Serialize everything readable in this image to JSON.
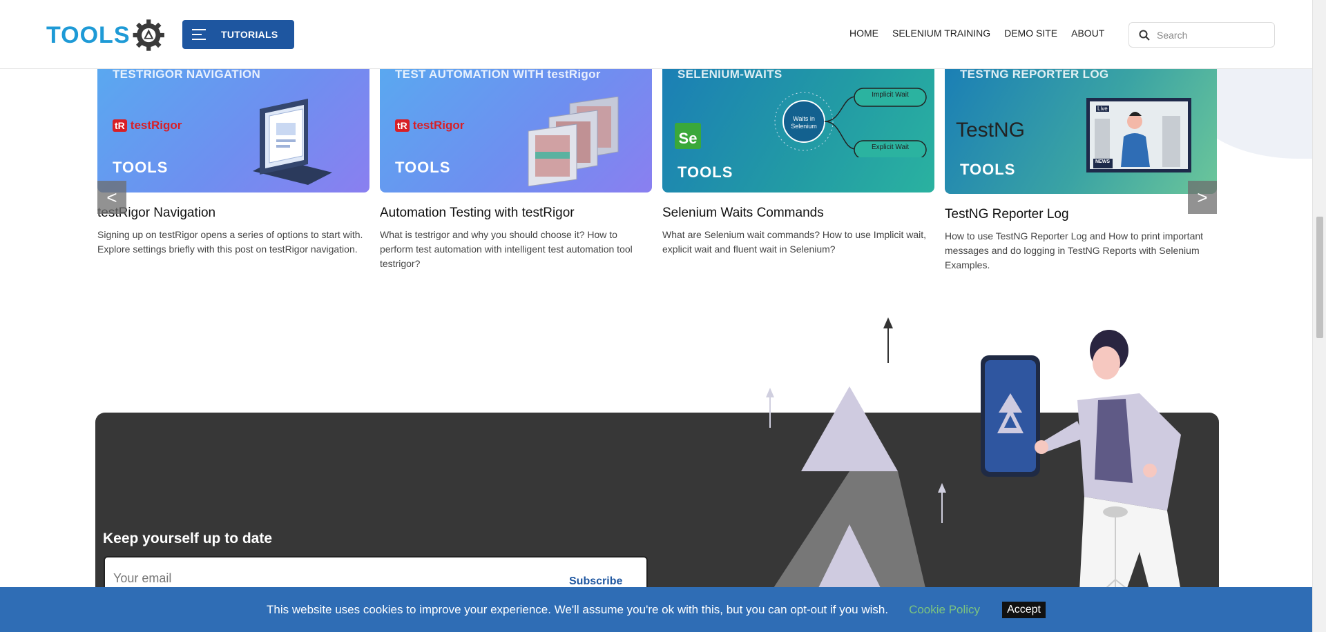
{
  "header": {
    "logo_text": "TOOLS",
    "tutorials_label": "TUTORIALS",
    "nav": [
      "HOME",
      "SELENIUM TRAINING",
      "DEMO SITE",
      "ABOUT"
    ],
    "search_placeholder": "Search"
  },
  "cards": [
    {
      "image_title": "TESTRIGOR NAVIGATION",
      "title": "testRigor Navigation",
      "description": "Signing up on testRigor opens a series of options to start with. Explore settings briefly with this post on testRigor navigation."
    },
    {
      "image_title": "TEST AUTOMATION WITH testRigor",
      "title": "Automation Testing with testRigor",
      "description": "What is testrigor and why you should choose it? How to perform test automation with intelligent test automation tool testrigor?"
    },
    {
      "image_title": "SELENIUM-WAITS",
      "title": "Selenium Waits Commands",
      "description": "What are Selenium wait commands? How to use Implicit wait, explicit wait and fluent wait in Selenium?",
      "diagram": {
        "center": "Waits in Selenium",
        "top": "Implicit Wait",
        "bottom": "Explicit Wait"
      }
    },
    {
      "image_title": "TESTNG REPORTER LOG",
      "title": "TestNG Reporter Log",
      "description": "How to use TestNG Reporter Log and How to print important messages and do logging in TestNG Reports with Selenium Examples.",
      "brand": "TestNG",
      "badge": "Live",
      "tv_label": "NEWS"
    }
  ],
  "image_brand": {
    "tools": "TOOLS",
    "testrigor_box": "tR",
    "testrigor_name": "testRigor",
    "selenium_badge": "Se"
  },
  "carousel": {
    "prev": "<",
    "next": ">"
  },
  "newsletter": {
    "title": "Keep yourself up to date",
    "email_placeholder": "Your email",
    "subscribe": "Subscribe"
  },
  "cookie": {
    "message": "This website uses cookies to improve your experience. We'll assume you're ok with this, but you can opt-out if you wish.",
    "policy": "Cookie Policy",
    "accept": "Accept"
  },
  "colors": {
    "primary": "#1e56a0",
    "logo_blue": "#1e9ad6",
    "cookie_bar": "#2f6db5",
    "newsletter_bg": "#373737"
  }
}
